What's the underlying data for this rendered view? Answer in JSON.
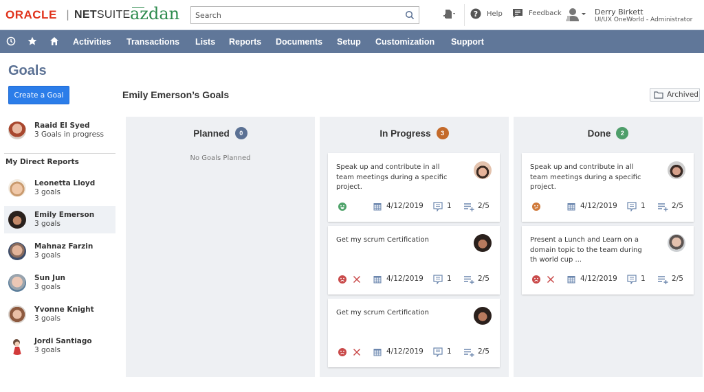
{
  "header": {
    "logo_oracle": "ORACLE",
    "logo_separator": "|",
    "logo_netsuite_bold": "NET",
    "logo_netsuite_rest": "SUITE",
    "logo_brand": "azdan",
    "search_placeholder": "Search",
    "help_label": "Help",
    "feedback_label": "Feedback",
    "user_name": "Derry Birkett",
    "user_role": "UI/UX OneWorld - Administrator"
  },
  "nav": {
    "icons": [
      "history-icon",
      "star-icon",
      "home-icon"
    ],
    "items": [
      "Activities",
      "Transactions",
      "Lists",
      "Reports",
      "Documents",
      "Setup",
      "Customization",
      "Support"
    ]
  },
  "sidebar": {
    "title": "Goals",
    "create_button": "Create a Goal",
    "self": {
      "name": "Raaid El Syed",
      "sub": "3 Goals in progress"
    },
    "section_label": "My Direct Reports",
    "reports": [
      {
        "name": "Leonetta Lloyd",
        "sub": "3 goals",
        "selected": false
      },
      {
        "name": "Emily Emerson",
        "sub": "3 goals",
        "selected": true
      },
      {
        "name": "Mahnaz Farzin",
        "sub": "3 goals",
        "selected": false
      },
      {
        "name": "Sun Jun",
        "sub": "3 goals",
        "selected": false
      },
      {
        "name": "Yvonne Knight",
        "sub": "3 goals",
        "selected": false
      },
      {
        "name": "Jordi Santiago",
        "sub": "3 goals",
        "selected": false
      }
    ]
  },
  "main": {
    "title": "Emily Emerson’s Goals",
    "archived_label": "Archived",
    "columns": [
      {
        "title": "Planned",
        "count": "0",
        "badge_color": "#5b7194",
        "empty_text": "No Goals Planned",
        "cards": []
      },
      {
        "title": "In Progress",
        "count": "3",
        "badge_color": "#c46a2a",
        "cards": [
          {
            "text": "Speak up and contribute in all team meetings during a specific project.",
            "mood": "happy",
            "mood_color": "#4fa36a",
            "show_x": false,
            "date": "4/12/2019",
            "comments": "1",
            "tasks": "2/5"
          },
          {
            "text": "Get my scrum Certification",
            "mood": "sad",
            "mood_color": "#c94a4a",
            "show_x": true,
            "date": "4/12/2019",
            "comments": "1",
            "tasks": "2/5"
          },
          {
            "text": "Get my scrum Certification",
            "mood": "sad",
            "mood_color": "#c94a4a",
            "show_x": true,
            "date": "4/12/2019",
            "comments": "1",
            "tasks": "2/5"
          }
        ]
      },
      {
        "title": "Done",
        "count": "2",
        "badge_color": "#4e9e6a",
        "cards": [
          {
            "text": "Speak up and contribute in all team meetings during a specific project.",
            "mood": "neutral",
            "mood_color": "#d07a3a",
            "show_x": false,
            "date": "4/12/2019",
            "comments": "1",
            "tasks": "2/5"
          },
          {
            "text": "Present a Lunch and Learn on a domain topic to the team during th world cup ...",
            "mood": "sad",
            "mood_color": "#c94a4a",
            "show_x": true,
            "date": "4/12/2019",
            "comments": "1",
            "tasks": "2/5"
          }
        ]
      }
    ]
  },
  "colors": {
    "nav_bg": "#607799",
    "title_blue": "#5b7194",
    "primary_button": "#2b7de9",
    "brand_green": "#2e8b4e",
    "oracle_red": "#e0321b"
  }
}
